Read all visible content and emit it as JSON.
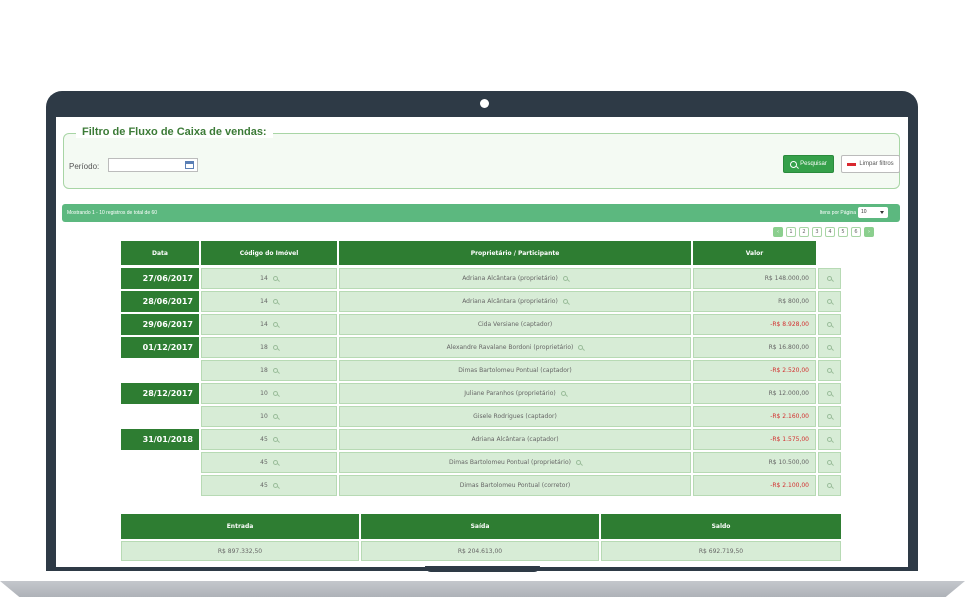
{
  "filter": {
    "title": "Filtro de Fluxo de Caixa de vendas:",
    "period_label": "Período:",
    "period_value": "",
    "search_label": "Pesquisar",
    "clear_label": "Limpar filtros"
  },
  "records": {
    "text": "Mostrando 1 - 10 registros de total de 60",
    "per_page_label": "Itens por Página",
    "per_page_value": "10"
  },
  "pagination": {
    "pages": [
      "1",
      "2",
      "3",
      "4",
      "5",
      "6"
    ]
  },
  "table": {
    "headers": [
      "Data",
      "Código do Imóvel",
      "Proprietário / Participante",
      "Valor"
    ],
    "rows": [
      {
        "date": "27/06/2017",
        "code": "14",
        "participant": "Adriana Alcântara (proprietário)",
        "value": "R$ 148.000,00",
        "negative": false
      },
      {
        "date": "28/06/2017",
        "code": "14",
        "participant": "Adriana Alcântara (proprietário)",
        "value": "R$ 800,00",
        "negative": false
      },
      {
        "date": "29/06/2017",
        "code": "14",
        "participant": "Cida Versiane (captador)",
        "value": "-R$ 8.928,00",
        "negative": true
      },
      {
        "date": "01/12/2017",
        "code": "18",
        "participant": "Alexandre Ravalane Bordoni (proprietário)",
        "value": "R$ 16.800,00",
        "negative": false
      },
      {
        "date": "",
        "code": "18",
        "participant": "Dimas Bartolomeu Pontual (captador)",
        "value": "-R$ 2.520,00",
        "negative": true
      },
      {
        "date": "28/12/2017",
        "code": "10",
        "participant": "Juliane Paranhos (proprietário)",
        "value": "R$ 12.000,00",
        "negative": false
      },
      {
        "date": "",
        "code": "10",
        "participant": "Gisele Rodrigues (captador)",
        "value": "-R$ 2.160,00",
        "negative": true
      },
      {
        "date": "31/01/2018",
        "code": "45",
        "participant": "Adriana Alcântara (captador)",
        "value": "-R$ 1.575,00",
        "negative": true
      },
      {
        "date": "",
        "code": "45",
        "participant": "Dimas Bartolomeu Pontual (proprietário)",
        "value": "R$ 10.500,00",
        "negative": false
      },
      {
        "date": "",
        "code": "45",
        "participant": "Dimas Bartolomeu Pontual (corretor)",
        "value": "-R$ 2.100,00",
        "negative": true
      }
    ]
  },
  "summary": {
    "headers": [
      "Entrada",
      "Saída",
      "Saldo"
    ],
    "values": [
      "R$ 897.332,50",
      "R$ 204.613,00",
      "R$ 692.719,50"
    ]
  },
  "colors": {
    "dark_green": "#2e7d32",
    "light_green": "#d7ecd6",
    "negative_red": "#d32f2f",
    "frame": "#2e3a46"
  }
}
